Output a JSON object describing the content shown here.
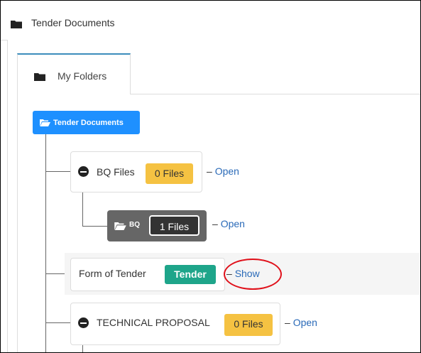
{
  "panel": {
    "title": "Tender Documents",
    "icon": "folder-icon"
  },
  "tabs": [
    {
      "label": "My Folders",
      "icon": "folder-icon"
    }
  ],
  "tree": {
    "root": {
      "label": "Tender Documents",
      "icon": "folder-open-icon",
      "color": "#1e90ff"
    },
    "items": [
      {
        "label": "BQ Files",
        "icon": "minus-circle-icon",
        "badge": "0 Files",
        "badge_color": "#f5c242",
        "link": "Open"
      },
      {
        "label": "BQ",
        "icon": "folder-open-icon",
        "badge": "1 Files",
        "badge_color": "#333333",
        "link": "Open"
      },
      {
        "label": "Form of Tender",
        "badge": "Tender",
        "badge_color": "#1ea58a",
        "link": "Show"
      },
      {
        "label": "TECHNICAL PROPOSAL",
        "icon": "minus-circle-icon",
        "badge": "0 Files",
        "badge_color": "#f5c242",
        "link": "Open"
      }
    ],
    "link_prefix": "–"
  },
  "annotation": {
    "shape": "ellipse",
    "color": "#e0101a"
  }
}
